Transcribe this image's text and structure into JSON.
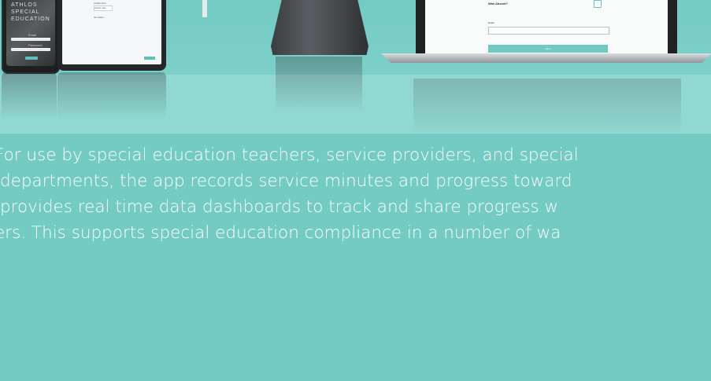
{
  "phone": {
    "brand_line1": "ATHLOS",
    "brand_line2": "SPECIAL",
    "brand_line3": "EDUCATION",
    "field1_label": "Email",
    "field2_label": "Password"
  },
  "tablet": {
    "section_label": "Assignment",
    "select_value": "Select logs",
    "no_status_label": "No status"
  },
  "laptop": {
    "question": "Was Absent?",
    "email_label": "Email",
    "submit_label": "Save"
  },
  "body_text": {
    "line1": "For use by special education teachers, service providers, and special",
    "line2": "departments, the app records service minutes and progress toward",
    "line3": "provides real time data dashboards to track and share progress w",
    "line4": "ers. This supports special education compliance in a number of wa"
  },
  "colors": {
    "background": "#74cbc4",
    "accent": "#5fc0b8",
    "text": "#ffffff"
  }
}
